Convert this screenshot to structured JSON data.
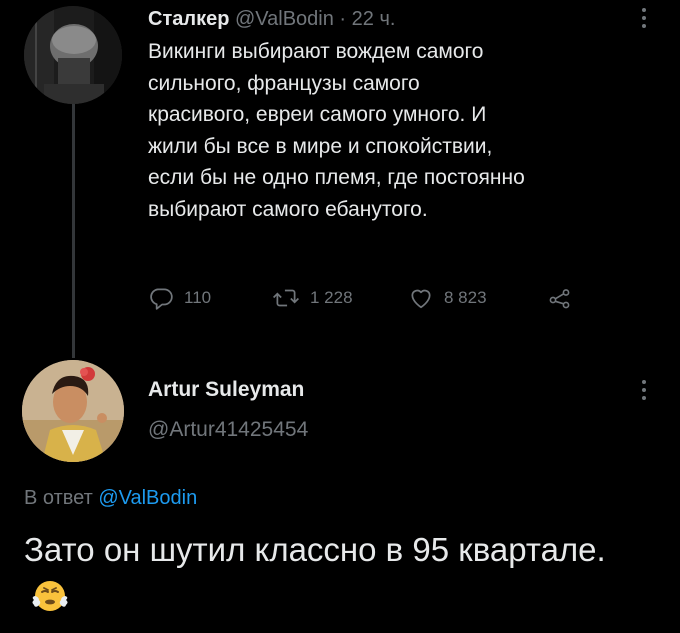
{
  "tweet1": {
    "author_name": "Сталкер",
    "author_handle": "@ValBodin",
    "separator": " · ",
    "time": "22 ч.",
    "text": "Викинги выбирают вождем самого\nсильного, французы самого\nкрасивого, евреи самого умного. И\nжили бы все в мире и спокойствии,\nесли бы не одно племя, где постоянно\nвыбирают самого ебанутого.",
    "replies": "110",
    "retweets": "1 228",
    "likes": "8 823",
    "icons": [
      "reply-icon",
      "retweet-icon",
      "like-icon",
      "share-icon",
      "more-icon"
    ]
  },
  "tweet2": {
    "author_name": "Artur Suleyman",
    "author_handle": "@Artur41425454",
    "reply_prefix": "В ответ ",
    "reply_mention": "@ValBodin",
    "text": "Зато он шутил классно в 95 квартале.",
    "emoji": "face-with-steam-from-nose"
  },
  "colors": {
    "background": "#000000",
    "primary_text": "#e7e9ea",
    "secondary_text": "#71767b",
    "link": "#1d9bf0",
    "thread_line": "#333639"
  }
}
